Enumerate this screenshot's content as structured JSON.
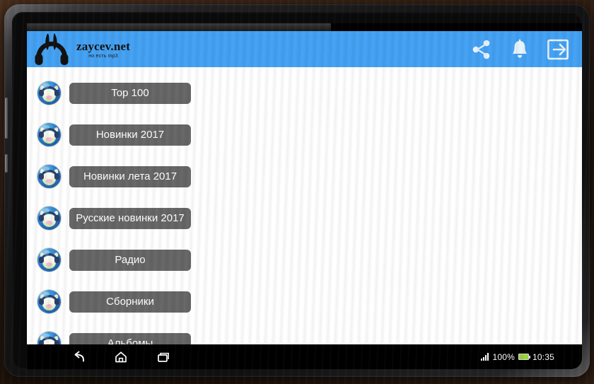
{
  "app": {
    "brand_name": "zaycev.net",
    "brand_tagline": "но есть mp3",
    "logo_icon": "bunny-headphones-logo",
    "header_color": "#44a1f3",
    "button_color": "#666666",
    "header_actions": [
      {
        "name": "share-icon",
        "label": "Share"
      },
      {
        "name": "bell-icon",
        "label": "Notifications"
      },
      {
        "name": "exit-icon",
        "label": "Exit"
      }
    ]
  },
  "menu": {
    "avatar_icon": "cow-headphones-avatar",
    "items": [
      {
        "label": "Top 100"
      },
      {
        "label": "Новинки 2017"
      },
      {
        "label": "Новинки лета 2017"
      },
      {
        "label": "Русские новинки 2017"
      },
      {
        "label": "Радио"
      },
      {
        "label": "Сборники"
      },
      {
        "label": "Альбомы"
      }
    ]
  },
  "navbar": {
    "buttons": [
      {
        "name": "back-icon",
        "label": "Back"
      },
      {
        "name": "home-icon",
        "label": "Home"
      },
      {
        "name": "recents-icon",
        "label": "Recent apps"
      }
    ],
    "signal_icon": "signal-bars-icon",
    "battery_percent": "100%",
    "battery_icon": "battery-full-icon",
    "battery_color": "#9ad33a",
    "clock": "10:35"
  }
}
